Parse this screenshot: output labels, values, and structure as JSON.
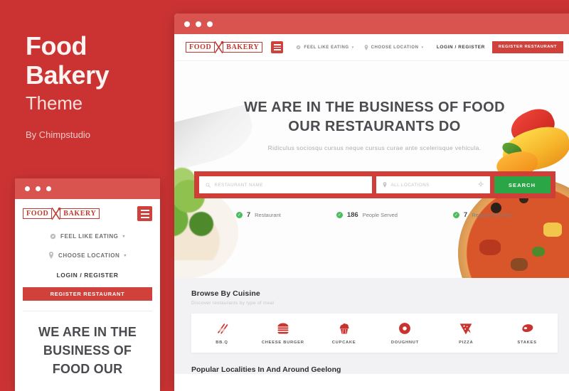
{
  "promo": {
    "title_line1": "Food",
    "title_line2": "Bakery",
    "subtitle": "Theme",
    "author": "By Chimpstudio"
  },
  "mobile": {
    "logo_left": "FOOD",
    "logo_right": "BAKERY",
    "menu_icon": "hamburger-icon",
    "nav": [
      {
        "icon": "compass-icon",
        "label": "FEEL LIKE EATING",
        "caret": "▾"
      },
      {
        "icon": "pin-icon",
        "label": "CHOOSE LOCATION",
        "caret": "▾"
      }
    ],
    "login_label": "LOGIN / REGISTER",
    "register_label": "REGISTER RESTAURANT",
    "hero_title": "WE ARE IN THE BUSINESS OF FOOD OUR"
  },
  "browser": {
    "titlebar_color": "#d9544e",
    "header": {
      "logo_left": "FOOD",
      "logo_right": "BAKERY",
      "menu_icon": "hamburger-icon",
      "nav": [
        {
          "icon": "compass-icon",
          "label": "FEEL LIKE EATING",
          "caret": "▾"
        },
        {
          "icon": "pin-icon",
          "label": "CHOOSE LOCATION",
          "caret": "▾"
        }
      ],
      "login_label": "LOGIN / REGISTER",
      "register_label": "REGISTER RESTAURANT"
    },
    "hero": {
      "title_line1": "WE ARE IN THE BUSINESS OF FOOD",
      "title_line2": "OUR RESTAURANTS DO",
      "subtitle": "Ridiculus sociosqu cursus neque cursus curae ante scelerisque vehicula."
    },
    "search": {
      "name_placeholder": "RESTAURANT NAME",
      "name_icon": "search-icon",
      "location_placeholder": "ALL LOCATIONS",
      "location_icon": "pin-icon",
      "geolocate_icon": "crosshair-icon",
      "button_label": "SEARCH",
      "button_color": "#2aa646",
      "frame_color": "#cf3f38"
    },
    "stats": [
      {
        "icon": "check-circle-icon",
        "value": "7",
        "label": "Restaurant"
      },
      {
        "icon": "check-circle-icon",
        "value": "186",
        "label": "People Served"
      },
      {
        "icon": "check-circle-icon",
        "value": "7",
        "label": "Registered Users"
      }
    ],
    "cuisine_section": {
      "title": "Browse By Cuisine",
      "subtitle": "Discover restaurants by type of meal",
      "items": [
        {
          "icon": "bbq-skewer-icon",
          "label": "BB.Q"
        },
        {
          "icon": "burger-icon",
          "label": "CHEESE BURGER"
        },
        {
          "icon": "cupcake-icon",
          "label": "CUPCAKE"
        },
        {
          "icon": "doughnut-icon",
          "label": "DOUGHNUT"
        },
        {
          "icon": "pizza-icon",
          "label": "PIZZA"
        },
        {
          "icon": "steak-icon",
          "label": "STAKES"
        }
      ]
    },
    "localities_title": "Popular Localities In And Around Geelong"
  },
  "theme": {
    "background_red": "#cb3333",
    "brand_red": "#d0413c",
    "accent_green": "#2aa646",
    "check_green": "#4bbd5c"
  }
}
